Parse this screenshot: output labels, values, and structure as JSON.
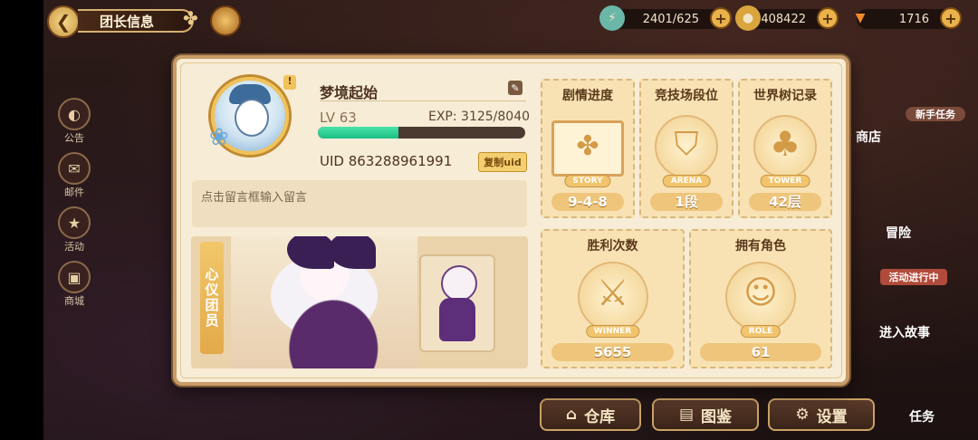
{
  "topbar": {
    "title": "团长信息",
    "back_icon": "back-arrow-icon",
    "resources": [
      {
        "name": "energy",
        "value": "2401/625",
        "icon": "energy-icon"
      },
      {
        "name": "gold",
        "value": "408422",
        "icon": "coin-icon"
      },
      {
        "name": "carrot",
        "value": "1716",
        "icon": "carrot-icon"
      }
    ]
  },
  "side_menu": [
    {
      "label": "公告",
      "icon": "announcement-icon"
    },
    {
      "label": "邮件",
      "icon": "mail-icon"
    },
    {
      "label": "活动",
      "icon": "event-icon"
    },
    {
      "label": "商城",
      "icon": "shop-icon"
    }
  ],
  "right_menu": {
    "newbie_task": "新手任务",
    "shop": "商店",
    "adventure": "冒险",
    "event_ongoing": "活动进行中",
    "enter_story": "进入故事"
  },
  "bottom_menu": {
    "warehouse": "仓库",
    "codex": "图鉴",
    "settings": "设置",
    "tasks": "任务"
  },
  "profile": {
    "name": "梦境起始",
    "level": "LV 63",
    "exp_text": "EXP: 3125/8040",
    "exp_fraction": 0.389,
    "uid": "UID 863288961991",
    "copy_label": "复制uid",
    "message_placeholder": "点击留言框输入留言",
    "favorite_label": "心仪团员"
  },
  "stats": {
    "story": {
      "title": "剧情进度",
      "tag": "STORY",
      "value": "9-4-8"
    },
    "arena": {
      "title": "竞技场段位",
      "tag": "ARENA",
      "value": "1段"
    },
    "tower": {
      "title": "世界树记录",
      "tag": "TOWER",
      "value": "42层"
    },
    "wins": {
      "title": "胜利次数",
      "tag": "WINNER",
      "value": "5655"
    },
    "roles": {
      "title": "拥有角色",
      "tag": "ROLE",
      "value": "61"
    }
  },
  "colors": {
    "panel_bg": "#f7ecd6",
    "exp_fill": "#1cbf86",
    "accent_gold": "#f1c56e"
  }
}
